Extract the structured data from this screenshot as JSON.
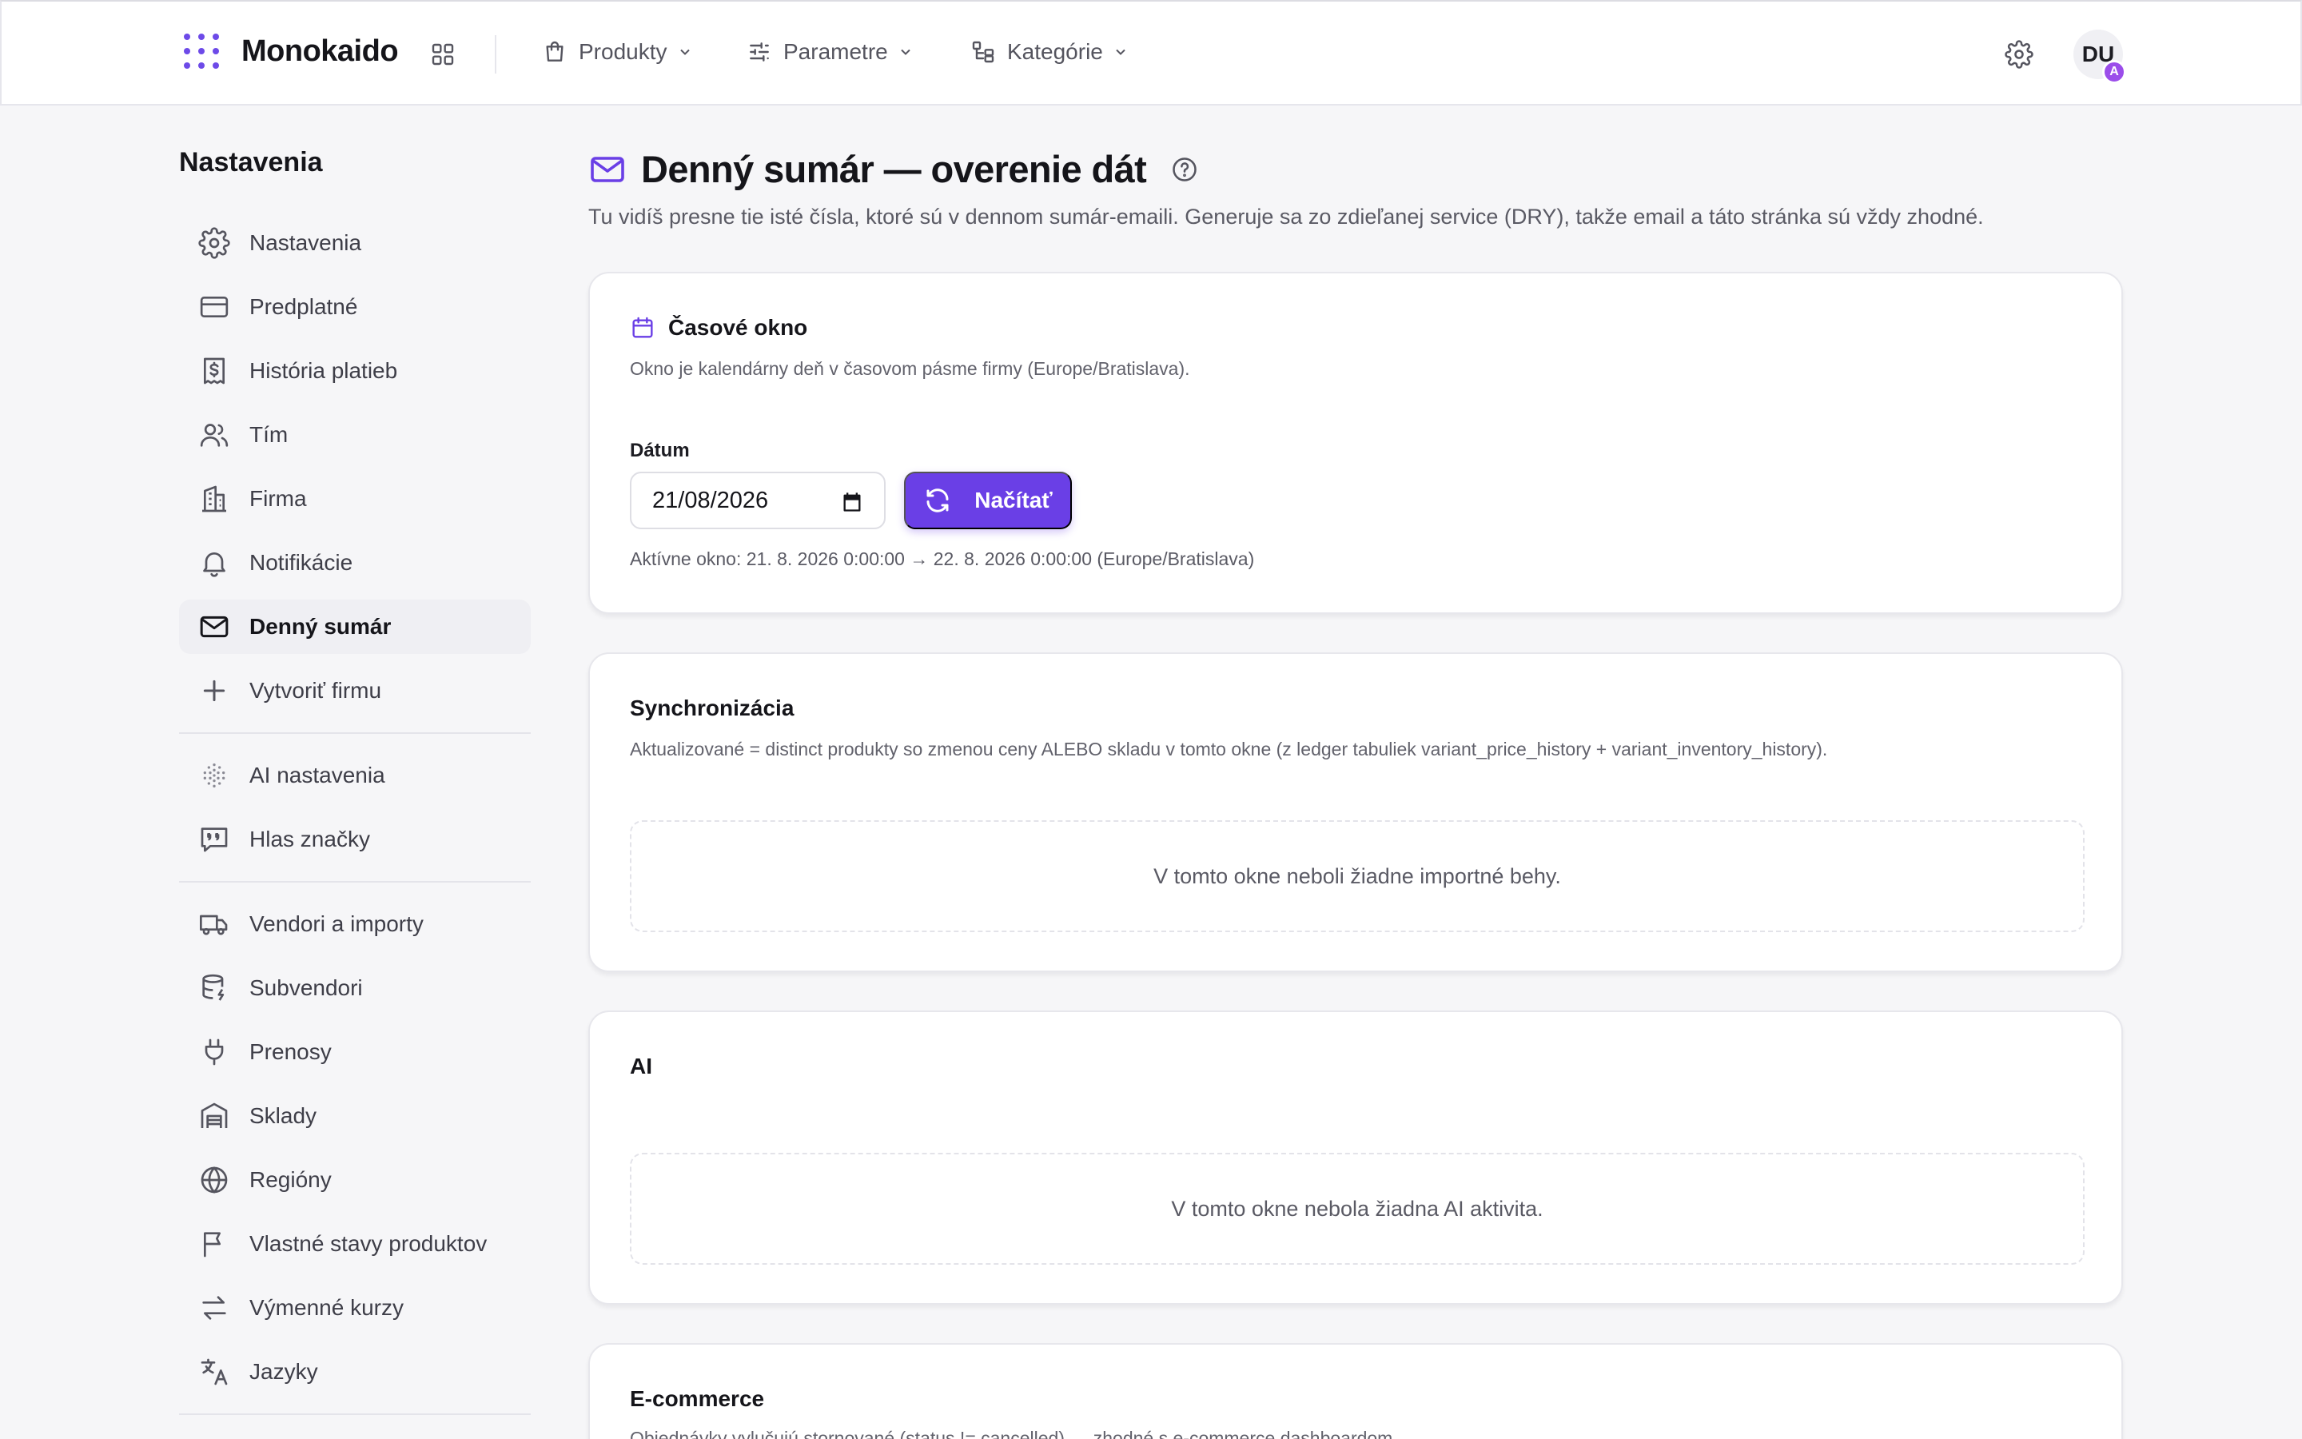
{
  "app": {
    "name": "Monokaido"
  },
  "nav": {
    "items": [
      {
        "label": "Produkty",
        "icon": "shopping-bag-icon"
      },
      {
        "label": "Parametre",
        "icon": "sliders-icon"
      },
      {
        "label": "Kategórie",
        "icon": "category-tree-icon"
      }
    ],
    "user_initials": "DU",
    "user_badge": "A"
  },
  "sidebar": {
    "title": "Nastavenia",
    "groups": [
      [
        {
          "label": "Nastavenia",
          "icon": "gear-icon"
        },
        {
          "label": "Predplatné",
          "icon": "credit-card-icon"
        },
        {
          "label": "História platieb",
          "icon": "receipt-dollar-icon"
        },
        {
          "label": "Tím",
          "icon": "users-icon"
        },
        {
          "label": "Firma",
          "icon": "building-icon"
        },
        {
          "label": "Notifikácie",
          "icon": "bell-icon"
        },
        {
          "label": "Denný sumár",
          "icon": "mail-icon",
          "active": true
        },
        {
          "label": "Vytvoriť firmu",
          "icon": "plus-icon"
        }
      ],
      [
        {
          "label": "AI nastavenia",
          "icon": "sparkle-dots-icon"
        },
        {
          "label": "Hlas značky",
          "icon": "quote-bubble-icon"
        }
      ],
      [
        {
          "label": "Vendori a importy",
          "icon": "truck-icon"
        },
        {
          "label": "Subvendori",
          "icon": "database-bolt-icon"
        },
        {
          "label": "Prenosy",
          "icon": "plug-icon"
        },
        {
          "label": "Sklady",
          "icon": "warehouse-icon"
        },
        {
          "label": "Regióny",
          "icon": "globe-icon"
        },
        {
          "label": "Vlastné stavy produktov",
          "icon": "flag-icon"
        },
        {
          "label": "Výmenné kurzy",
          "icon": "arrows-exchange-icon"
        },
        {
          "label": "Jazyky",
          "icon": "translate-icon"
        }
      ]
    ]
  },
  "page": {
    "title": "Denný sumár — overenie dát",
    "subtitle": "Tu vidíš presne tie isté čísla, ktoré sú v dennom sumár-emaili. Generuje sa zo zdieľanej service (DRY), takže email a táto stránka sú vždy zhodné."
  },
  "cards": {
    "window": {
      "title": "Časové okno",
      "desc": "Okno je kalendárny deň v časovom pásme firmy (Europe/Bratislava).",
      "date_label": "Dátum",
      "date_value": "21/08/2026",
      "load_label": "Načítať",
      "active_window": "Aktívne okno: 21. 8. 2026 0:00:00 → 22. 8. 2026 0:00:00 (Europe/Bratislava)"
    },
    "sync": {
      "title": "Synchronizácia",
      "desc": "Aktualizované = distinct produkty so zmenou ceny ALEBO skladu v tomto okne (z ledger tabuliek variant_price_history + variant_inventory_history).",
      "empty": "V tomto okne neboli žiadne importné behy."
    },
    "ai": {
      "title": "AI",
      "empty": "V tomto okne nebola žiadna AI aktivita."
    },
    "ecommerce": {
      "title": "E-commerce",
      "desc": "Objednávky vylučujú stornované (status != cancelled) — zhodné s e-commerce dashboardom."
    }
  },
  "colors": {
    "accent": "#6a3fe6",
    "logo": "#6d4ae8",
    "badge": "#9b4dea"
  }
}
